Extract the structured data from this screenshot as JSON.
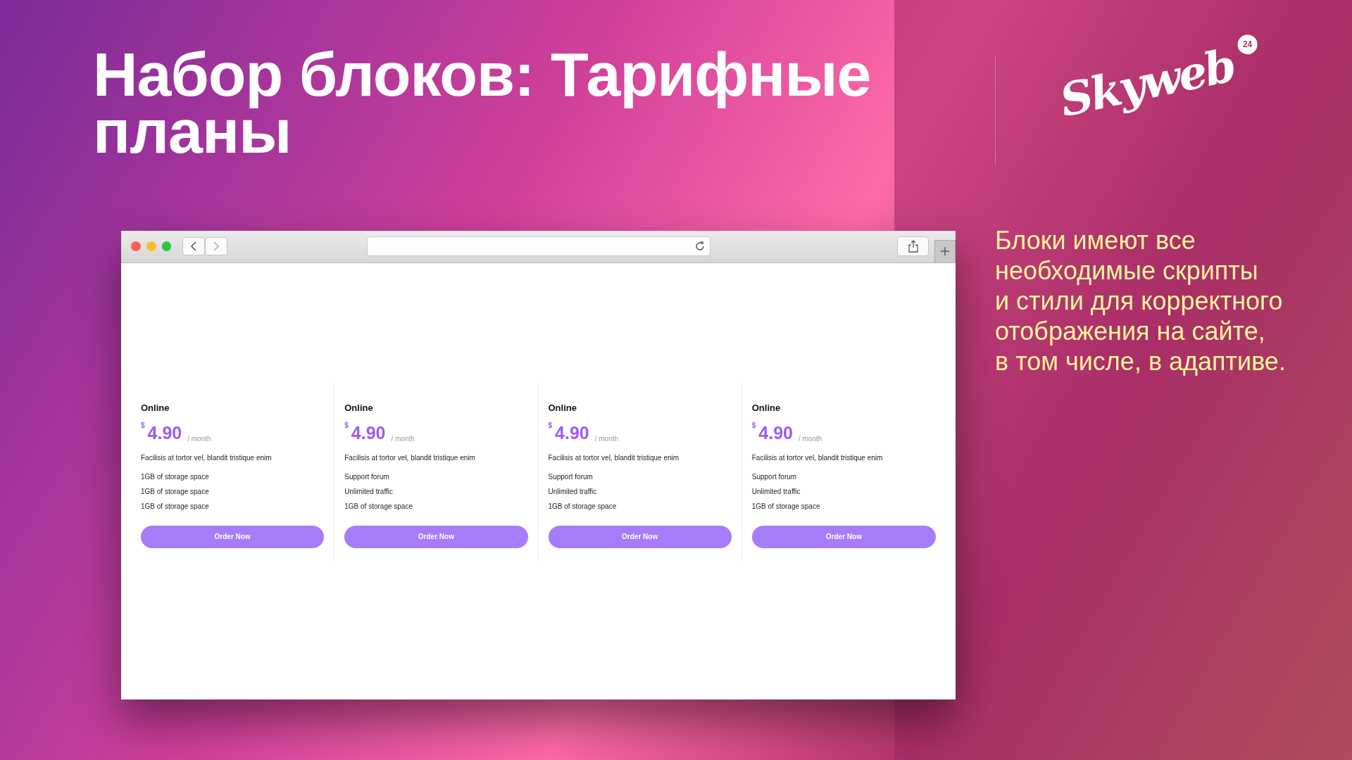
{
  "slide": {
    "title": "Набор блоков: Тарифные планы",
    "description": "Блоки имеют все\nнеобходимые скрипты\nи стили для корректного\nотображения на сайте,\nв том числе, в адаптиве.",
    "logo": {
      "text": "Skyweb",
      "badge": "24"
    }
  },
  "browser": {
    "plans": [
      {
        "name": "Online",
        "currency": "$",
        "price": "4.90",
        "period": "/ month",
        "summary": "Facilisis at tortor vel, blandit tristique enim",
        "features": [
          "1GB of storage space",
          "1GB of storage space",
          "1GB of storage space"
        ],
        "button": "Order Now"
      },
      {
        "name": "Online",
        "currency": "$",
        "price": "4.90",
        "period": "/ month",
        "summary": "Facilisis at tortor vel, blandit tristique enim",
        "features": [
          "Support forum",
          "Unlimited traffic",
          "1GB of storage space"
        ],
        "button": "Order Now"
      },
      {
        "name": "Online",
        "currency": "$",
        "price": "4.90",
        "period": "/ month",
        "summary": "Facilisis at tortor vel, blandit tristique enim",
        "features": [
          "Support forum",
          "Unlimited traffic",
          "1GB of storage space"
        ],
        "button": "Order Now"
      },
      {
        "name": "Online",
        "currency": "$",
        "price": "4.90",
        "period": "/ month",
        "summary": "Facilisis at tortor vel, blandit tristique enim",
        "features": [
          "Support forum",
          "Unlimited traffic",
          "1GB of storage space"
        ],
        "button": "Order Now"
      }
    ]
  }
}
